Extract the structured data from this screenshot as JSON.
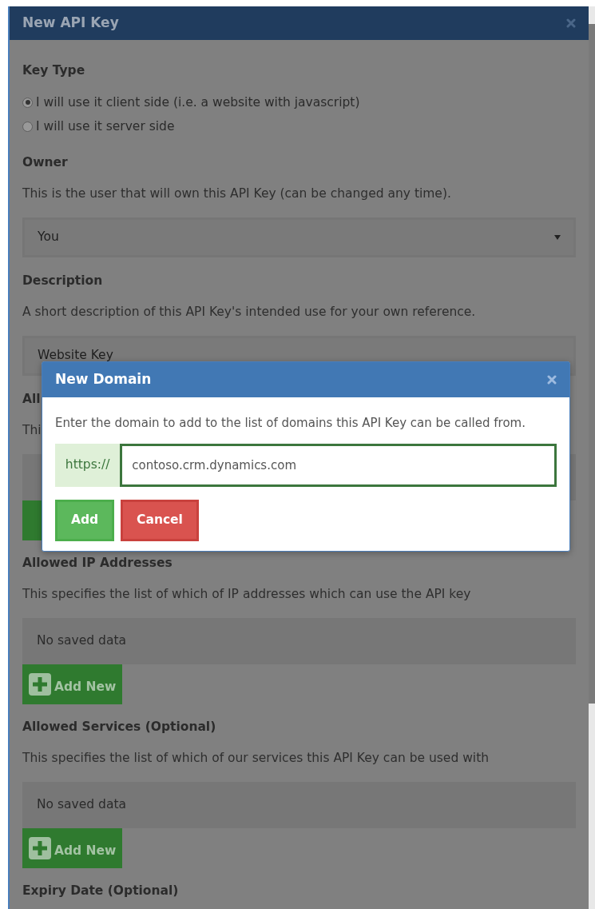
{
  "window": {
    "title": "New API Key"
  },
  "sections": [
    {
      "kind": "radios",
      "heading": "Key Type",
      "options": [
        {
          "label": "I will use it client side (i.e. a website with javascript)",
          "selected": true
        },
        {
          "label": "I will use it server side",
          "selected": false
        }
      ]
    },
    {
      "kind": "select",
      "heading": "Owner",
      "description": "This is the user that will own this API Key (can be changed any time).",
      "value": "You"
    },
    {
      "kind": "text",
      "heading": "Description",
      "description": "A short description of this API Key's intended use for your own reference.",
      "value": "Website Key"
    },
    {
      "kind": "list",
      "heading": "All",
      "description": "Thi"
    },
    {
      "kind": "list",
      "heading": "Allowed IP Addresses",
      "description": "This specifies the list of which of IP addresses which can use the API key",
      "empty_text": "No saved data",
      "button": "Add New"
    },
    {
      "kind": "list",
      "heading": "Allowed Services (Optional)",
      "description": "This specifies the list of which of our services this API Key can be used with",
      "empty_text": "No saved data",
      "button": "Add New"
    },
    {
      "kind": "heading",
      "heading": "Expiry Date (Optional)"
    }
  ],
  "dialog": {
    "title": "New Domain",
    "message": "Enter the domain to add to the list of domains this API Key can be called from.",
    "prefix": "https://",
    "value": "contoso.crm.dynamics.com",
    "buttons": [
      {
        "label": "Add",
        "kind": "success"
      },
      {
        "label": "Cancel",
        "kind": "danger"
      }
    ]
  }
}
